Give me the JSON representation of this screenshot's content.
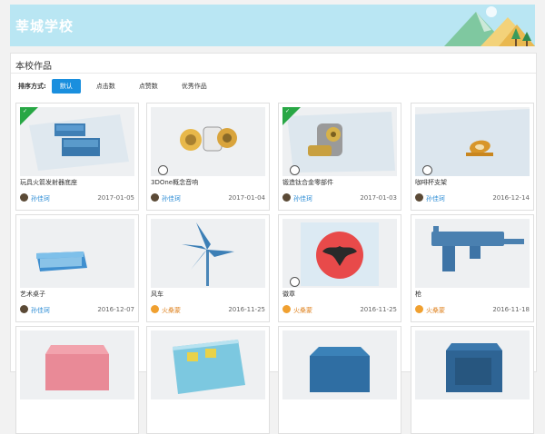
{
  "school": {
    "title": "莘城学校"
  },
  "section": {
    "title": "本校作品"
  },
  "sort": {
    "label": "排序方式:",
    "options": [
      "默认",
      "点击数",
      "点赞数",
      "优秀作品"
    ],
    "active": "默认"
  },
  "works": [
    {
      "title": "玩具火箭发射器底座",
      "author": "孙佳珂",
      "date": "2017-01-05",
      "featured": true
    },
    {
      "title": "3DOne概念音响",
      "author": "孙佳珂",
      "date": "2017-01-04",
      "featured": false
    },
    {
      "title": "锻造钛合金零部件",
      "author": "孙佳珂",
      "date": "2017-01-03",
      "featured": true
    },
    {
      "title": "咖啡杯支架",
      "author": "孙佳珂",
      "date": "2016-12-14",
      "featured": false
    },
    {
      "title": "艺术桌子",
      "author": "孙佳珂",
      "date": "2016-12-07",
      "featured": false
    },
    {
      "title": "风车",
      "author": "火桑蒙",
      "date": "2016-11-25",
      "featured": false
    },
    {
      "title": "徽章",
      "author": "火桑蒙",
      "date": "2016-11-25",
      "featured": false
    },
    {
      "title": "枪",
      "author": "火桑蒙",
      "date": "2016-11-18",
      "featured": false
    }
  ],
  "colors": {
    "accent": "#1a8fde",
    "badge": "#28a745",
    "banner": "#b9e6f3"
  }
}
